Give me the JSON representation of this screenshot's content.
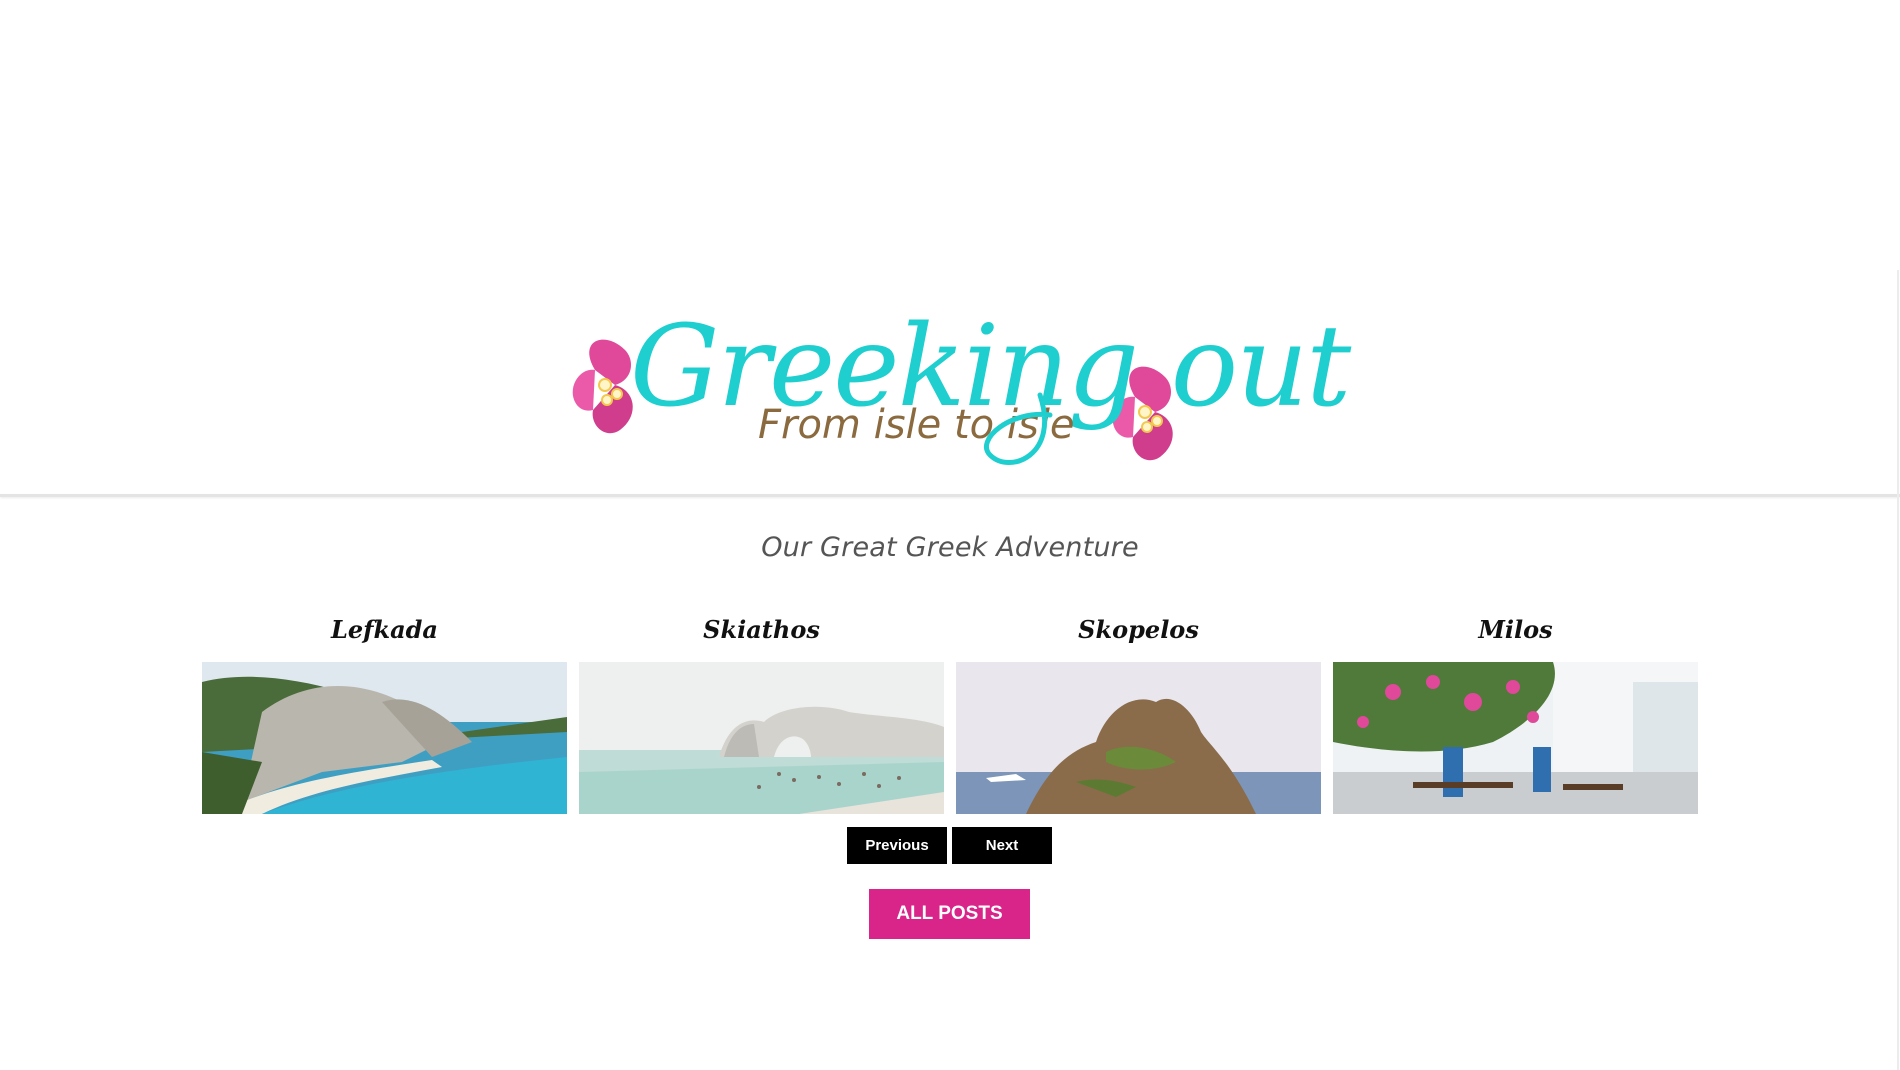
{
  "header": {
    "logo_title": "Greeking out",
    "logo_subtitle": "From isle to isle"
  },
  "tagline": "Our Great Greek Adventure",
  "gallery": {
    "items": [
      {
        "label": "Lefkada"
      },
      {
        "label": "Skiathos"
      },
      {
        "label": "Skopelos"
      },
      {
        "label": "Milos"
      }
    ]
  },
  "pager": {
    "previous_label": "Previous",
    "next_label": "Next"
  },
  "all_posts_label": "ALL POSTS",
  "colors": {
    "logo_teal": "#1fcfcf",
    "logo_brown": "#8a6a3e",
    "flower_pink": "#e0489a",
    "accent_pink": "#d9258a",
    "button_black": "#000000"
  }
}
